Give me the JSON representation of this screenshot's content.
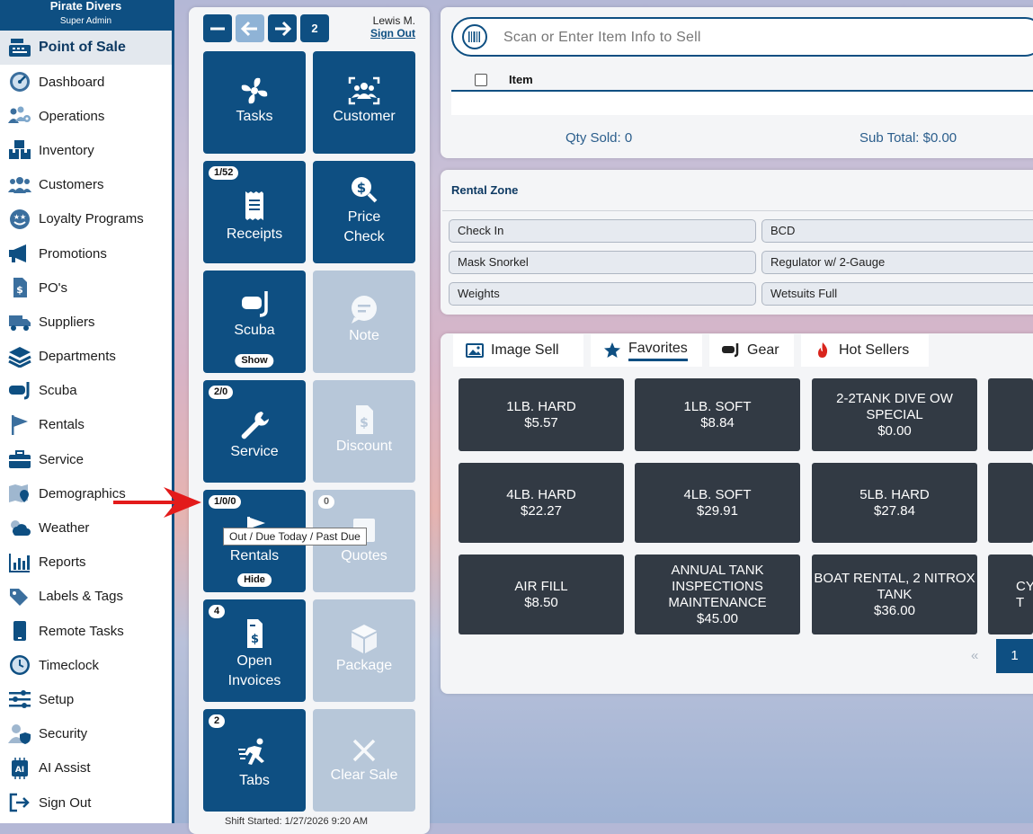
{
  "sidebar": {
    "org": "Pirate Divers",
    "role": "Super Admin",
    "items": [
      {
        "label": "Point of Sale",
        "icon": "register-icon"
      },
      {
        "label": "Dashboard",
        "icon": "gauge-icon"
      },
      {
        "label": "Operations",
        "icon": "operations-icon"
      },
      {
        "label": "Inventory",
        "icon": "boxes-icon"
      },
      {
        "label": "Customers",
        "icon": "users-icon"
      },
      {
        "label": "Loyalty Programs",
        "icon": "loyalty-icon"
      },
      {
        "label": "Promotions",
        "icon": "megaphone-icon"
      },
      {
        "label": "PO's",
        "icon": "po-file-icon"
      },
      {
        "label": "Suppliers",
        "icon": "truck-icon"
      },
      {
        "label": "Departments",
        "icon": "layers-icon"
      },
      {
        "label": "Scuba",
        "icon": "mask-icon"
      },
      {
        "label": "Rentals",
        "icon": "flag-icon"
      },
      {
        "label": "Service",
        "icon": "toolbox-icon"
      },
      {
        "label": "Demographics",
        "icon": "map-pin-icon"
      },
      {
        "label": "Weather",
        "icon": "weather-icon"
      },
      {
        "label": "Reports",
        "icon": "chart-icon"
      },
      {
        "label": "Labels & Tags",
        "icon": "tags-icon"
      },
      {
        "label": "Remote Tasks",
        "icon": "tablet-icon"
      },
      {
        "label": "Timeclock",
        "icon": "clock-icon"
      },
      {
        "label": "Setup",
        "icon": "sliders-icon"
      },
      {
        "label": "Security",
        "icon": "user-shield-icon"
      },
      {
        "label": "AI Assist",
        "icon": "ai-chip-icon"
      },
      {
        "label": "Sign Out",
        "icon": "sign-out-icon"
      }
    ]
  },
  "nav": {
    "count": "2"
  },
  "user": {
    "name": "Lewis M.",
    "signout": "Sign Out"
  },
  "tiles": {
    "tasks": "Tasks",
    "customer": "Customer",
    "receipts": "Receipts",
    "receipts_badge": "1/52",
    "price_check_1": "Price",
    "price_check_2": "Check",
    "scuba": "Scuba",
    "scuba_pill": "Show",
    "note": "Note",
    "service": "Service",
    "service_badge": "2/0",
    "discount": "Discount",
    "rentals": "Rentals",
    "rentals_badge": "1/0/0",
    "rentals_pill": "Hide",
    "quotes": "Quotes",
    "quotes_badge": "0",
    "open_invoices_1": "Open",
    "open_invoices_2": "Invoices",
    "open_invoices_badge": "4",
    "package": "Package",
    "tabs": "Tabs",
    "tabs_badge": "2",
    "clear_sale": "Clear Sale"
  },
  "tooltip": "Out / Due Today / Past Due",
  "shift": "Shift Started: 1/27/2026 9:20 AM",
  "scan": {
    "placeholder": "Scan or Enter Item Info to Sell"
  },
  "item_table": {
    "header": "Item"
  },
  "totals": {
    "qty": "Qty Sold: 0",
    "subtotal": "Sub Total: $0.00"
  },
  "rental_zone": {
    "title": "Rental Zone",
    "buttons": [
      "Check In",
      "BCD",
      "Mask Snorkel",
      "Regulator w/ 2-Gauge",
      "Weights",
      "Wetsuits Full"
    ]
  },
  "tabs": [
    {
      "label": "Image Sell",
      "icon": "image-icon"
    },
    {
      "label": "Favorites",
      "icon": "star-icon",
      "active": true
    },
    {
      "label": "Gear",
      "icon": "mask-icon"
    },
    {
      "label": "Hot Sellers",
      "icon": "fire-icon"
    }
  ],
  "products": [
    {
      "name": "1LB. HARD",
      "price": "$5.57"
    },
    {
      "name": "1LB. SOFT",
      "price": "$8.84"
    },
    {
      "name": "2-2TANK DIVE OW SPECIAL",
      "price": "$0.00"
    },
    {
      "name": "4LB. HARD",
      "price": "$22.27"
    },
    {
      "name": "4LB. SOFT",
      "price": "$29.91"
    },
    {
      "name": "5LB. HARD",
      "price": "$27.84"
    },
    {
      "name": "AIR FILL",
      "price": "$8.50"
    },
    {
      "name": "ANNUAL TANK INSPECTIONS MAINTENANCE",
      "price": "$45.00"
    },
    {
      "name": "BOAT RENTAL, 2 NITROX TANK",
      "price": "$36.00"
    },
    {
      "name": "CY T",
      "price": ""
    }
  ],
  "pagination": {
    "prev": "«",
    "current": "1"
  },
  "colors": {
    "primary": "#0e4f82",
    "product_bg": "#323a44",
    "disabled_tile": "#b7c7d9",
    "arrow": "#e31b1b"
  }
}
